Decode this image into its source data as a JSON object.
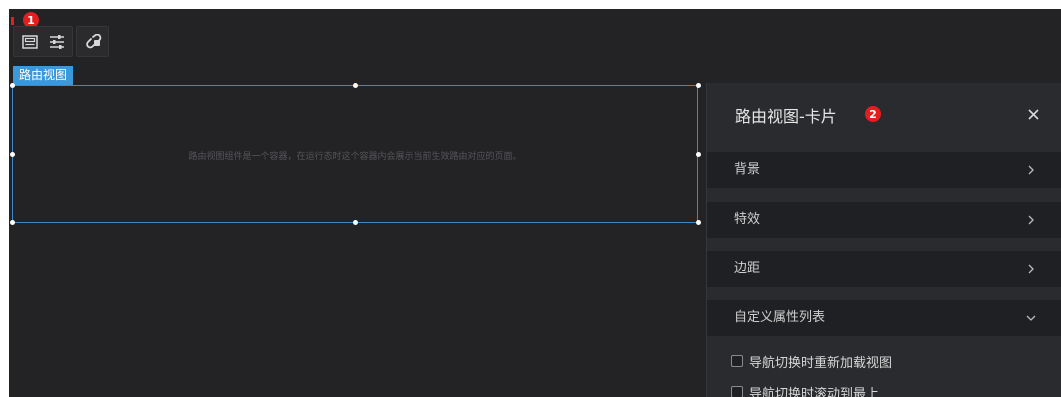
{
  "toolbar": {
    "icons": [
      "image-icon",
      "sliders-icon",
      "link-unlink-icon"
    ],
    "badge": "1"
  },
  "component": {
    "label": "路由视图",
    "description": "路由视图组件是一个容器，在运行态时这个容器内会展示当前生效路由对应的页面。"
  },
  "panel": {
    "title": "路由视图-卡片",
    "badge": "2",
    "sections": [
      {
        "label": "背景",
        "state": "collapsed"
      },
      {
        "label": "特效",
        "state": "collapsed"
      },
      {
        "label": "边距",
        "state": "collapsed"
      },
      {
        "label": "自定义属性列表",
        "state": "expanded"
      }
    ],
    "options": [
      {
        "label": "导航切换时重新加载视图",
        "checked": false
      },
      {
        "label": "导航切换时滚动到最上",
        "checked": false
      }
    ]
  },
  "colors": {
    "canvas": "#232325",
    "panel": "#2a2b2e",
    "accent": "#3d98d9",
    "badge": "#e41e1e"
  }
}
